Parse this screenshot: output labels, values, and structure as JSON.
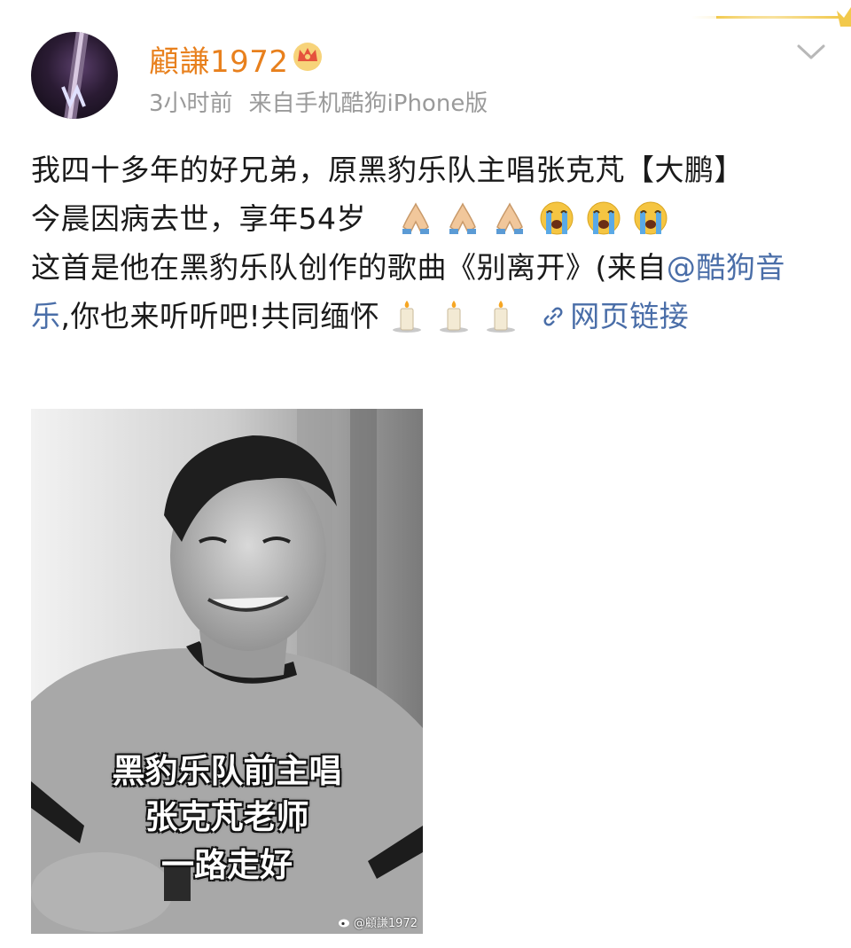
{
  "user": {
    "name": "顧謙1972",
    "time": "3小时前",
    "source": "来自手机酷狗iPhone版"
  },
  "post": {
    "line1": "我四十多年的好兄弟，原黑豹乐队主唱张克芃【大鹏】",
    "line2": "今晨因病去世，享年54岁",
    "line3_prefix": "这首是他在黑豹乐队创作的歌曲《别离开》(来自",
    "mention": "@酷狗音乐",
    "line4_suffix": ",你也来听听吧!共同缅怀",
    "web_link": "网页链接"
  },
  "photo": {
    "caption_lines": [
      "黑豹乐队前主唱",
      "张克芃老师",
      "一路走好"
    ],
    "watermark": "@顧謙1972"
  },
  "colors": {
    "username": "#e8801d",
    "link": "#4a6ea8",
    "meta": "#9a9a9a",
    "crown": "#f2c94c"
  },
  "icons": {
    "prayer": "folded-hands-emoji",
    "crying": "loudly-crying-face-emoji",
    "candle": "candle-emoji",
    "link": "chain-link-icon",
    "menu": "chevron-down-icon",
    "vip": "crown-badge-icon"
  }
}
